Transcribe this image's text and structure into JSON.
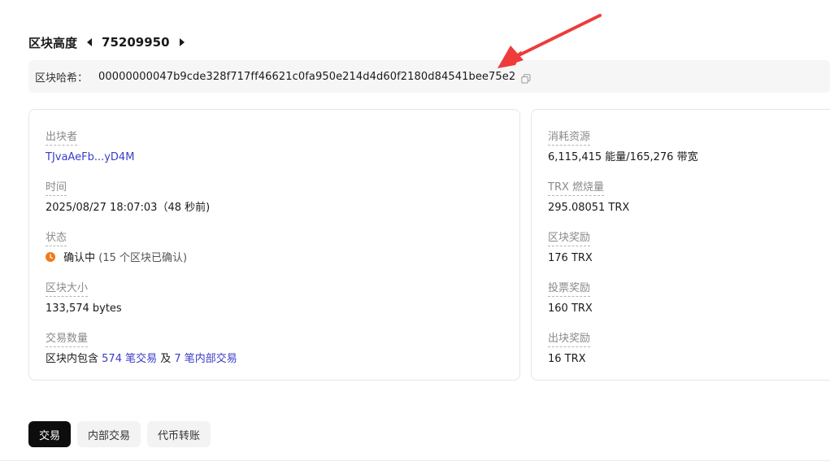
{
  "header": {
    "title": "区块高度",
    "block_number": "75209950"
  },
  "hash": {
    "label": "区块哈希：",
    "value": "00000000047b9cde328f717ff46621c0fa950e214d4d60f2180d84541bee75e2"
  },
  "left_card": {
    "producer": {
      "label": "出块者",
      "value": "TJvaAeFb...yD4M"
    },
    "time": {
      "label": "时间",
      "value": "2025/08/27 18:07:03（48 秒前)"
    },
    "status": {
      "label": "状态",
      "value": "确认中",
      "detail": "(15 个区块已确认)",
      "color": "#f07b19"
    },
    "size": {
      "label": "区块大小",
      "value": "133,574 bytes"
    },
    "tx_count": {
      "label": "交易数量",
      "prefix": "区块内包含",
      "tx_link": "574 笔交易",
      "conj": "及",
      "internal_link": "7 笔内部交易"
    }
  },
  "right_card": {
    "resources": {
      "label": "消耗资源",
      "value": "6,115,415 能量/165,276 带宽"
    },
    "trx_burn": {
      "label": "TRX 燃烧量",
      "value": "295.08051 TRX"
    },
    "block_reward": {
      "label": "区块奖励",
      "value": "176 TRX"
    },
    "vote_reward": {
      "label": "投票奖励",
      "value": "160 TRX"
    },
    "producer_reward": {
      "label": "出块奖励",
      "value": "16 TRX"
    }
  },
  "tabs": [
    {
      "label": "交易",
      "active": true
    },
    {
      "label": "内部交易",
      "active": false
    },
    {
      "label": "代币转账",
      "active": false
    }
  ],
  "colors": {
    "link": "#3c3cc9",
    "annotation_arrow": "#ee3b3b",
    "active_tab": "#0d0d0d"
  }
}
